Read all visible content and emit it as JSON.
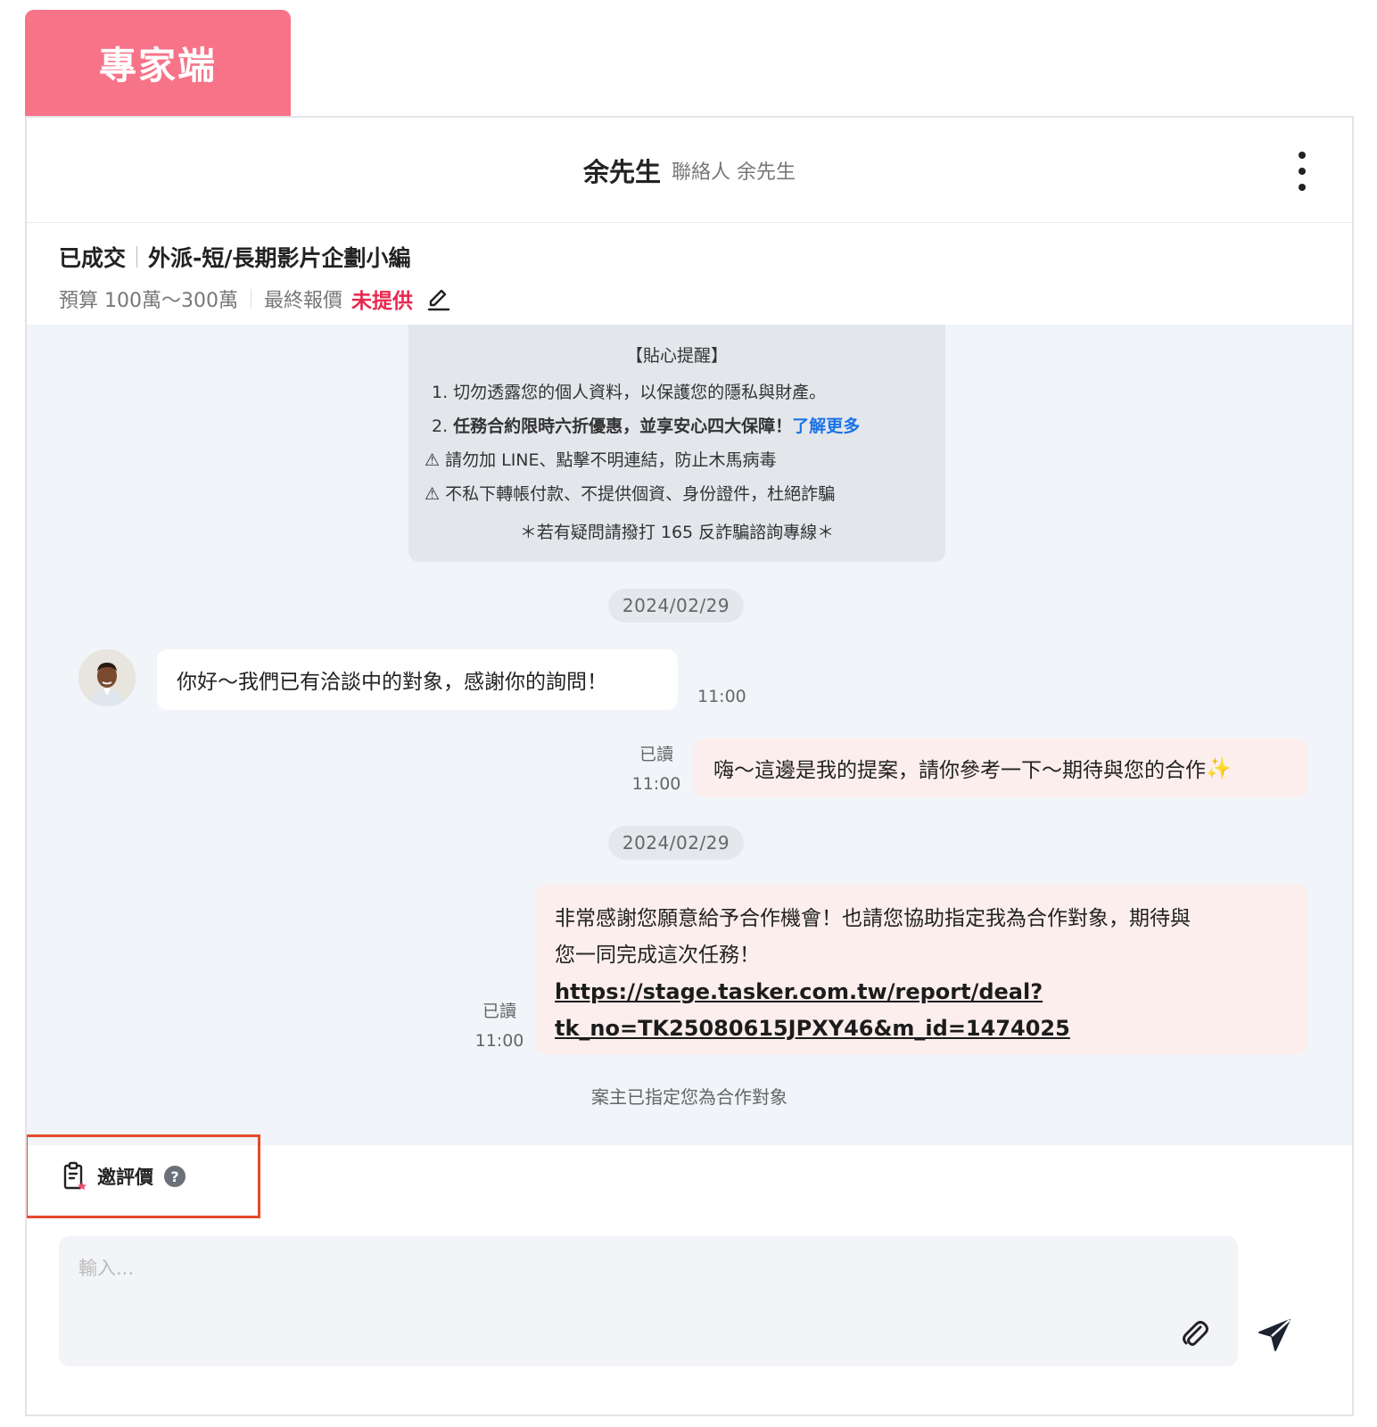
{
  "role_tab": {
    "label": "專家端"
  },
  "header": {
    "name": "余先生",
    "contact": "聯絡人 余先生",
    "more_icon": "kebab-menu-icon"
  },
  "task": {
    "status": "已成交",
    "title": "外派-短/長期影片企劃小編",
    "budget": "預算 100萬～300萬",
    "final_quote_label": "最終報價",
    "final_quote_value": "未提供",
    "edit_icon": "pencil-icon"
  },
  "tips": {
    "title": "【貼心提醒】",
    "line1": "1. 切勿透露您的個人資料，以保護您的隱私與財產。",
    "line2_prefix": "2. ",
    "line2_bold": "任務合約限時六折優惠，並享安心四大保障！",
    "line2_link": "了解更多",
    "warning1": "請勿加 LINE、點擊不明連結，防止木馬病毒",
    "warning2": "不私下轉帳付款、不提供個資、身份證件，杜絕詐騙",
    "warning_icon": "warning-triangle-icon",
    "footer": "＊若有疑問請撥打 165 反詐騙諮詢專線＊"
  },
  "messages": {
    "date1": "2024/02/29",
    "incoming_text": "你好～我們已有洽談中的對象，感謝你的詢問！",
    "incoming_time": "11:00",
    "out1_read": "已讀",
    "out1_time": "11:00",
    "out1_text": "嗨～這邊是我的提案，請你參考一下～期待與您的合作",
    "out1_emoji": "✨",
    "date2": "2024/02/29",
    "out2_read": "已讀",
    "out2_time": "11:00",
    "out2_text_line1": "非常感謝您願意給予合作機會！也請您協助指定我為合作對象，期待與",
    "out2_text_line2": "您一同完成這次任務！",
    "out2_link_line1": "https://stage.tasker.com.tw/report/deal?",
    "out2_link_line2": "tk_no=TK25080615JPXY46&m_id=1474025",
    "system_notice": "案主已指定您為合作對象"
  },
  "invite": {
    "label": "邀評價",
    "help": "?",
    "icon": "clipboard-star-icon"
  },
  "composer": {
    "placeholder": "輸入...",
    "attach_icon": "paperclip-icon",
    "send_icon": "send-icon"
  },
  "colors": {
    "brand_pink": "#f77388",
    "danger": "#e8284f",
    "link_blue": "#1a73e8",
    "outgoing_bubble": "#fdeeee",
    "highlight_border": "#e64a2b"
  }
}
